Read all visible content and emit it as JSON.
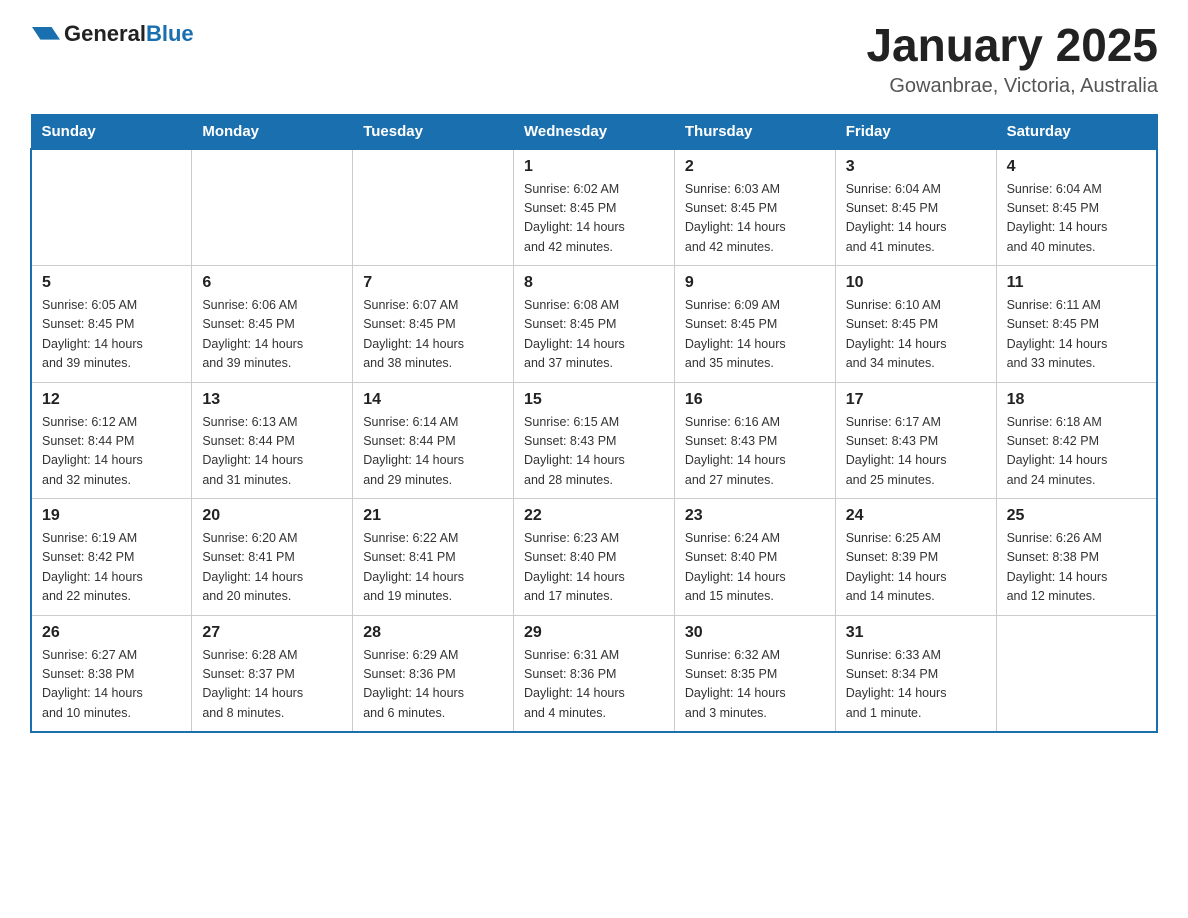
{
  "logo": {
    "general": "General",
    "blue": "Blue"
  },
  "title": "January 2025",
  "location": "Gowanbrae, Victoria, Australia",
  "days_of_week": [
    "Sunday",
    "Monday",
    "Tuesday",
    "Wednesday",
    "Thursday",
    "Friday",
    "Saturday"
  ],
  "weeks": [
    [
      {
        "day": "",
        "info": ""
      },
      {
        "day": "",
        "info": ""
      },
      {
        "day": "",
        "info": ""
      },
      {
        "day": "1",
        "info": "Sunrise: 6:02 AM\nSunset: 8:45 PM\nDaylight: 14 hours\nand 42 minutes."
      },
      {
        "day": "2",
        "info": "Sunrise: 6:03 AM\nSunset: 8:45 PM\nDaylight: 14 hours\nand 42 minutes."
      },
      {
        "day": "3",
        "info": "Sunrise: 6:04 AM\nSunset: 8:45 PM\nDaylight: 14 hours\nand 41 minutes."
      },
      {
        "day": "4",
        "info": "Sunrise: 6:04 AM\nSunset: 8:45 PM\nDaylight: 14 hours\nand 40 minutes."
      }
    ],
    [
      {
        "day": "5",
        "info": "Sunrise: 6:05 AM\nSunset: 8:45 PM\nDaylight: 14 hours\nand 39 minutes."
      },
      {
        "day": "6",
        "info": "Sunrise: 6:06 AM\nSunset: 8:45 PM\nDaylight: 14 hours\nand 39 minutes."
      },
      {
        "day": "7",
        "info": "Sunrise: 6:07 AM\nSunset: 8:45 PM\nDaylight: 14 hours\nand 38 minutes."
      },
      {
        "day": "8",
        "info": "Sunrise: 6:08 AM\nSunset: 8:45 PM\nDaylight: 14 hours\nand 37 minutes."
      },
      {
        "day": "9",
        "info": "Sunrise: 6:09 AM\nSunset: 8:45 PM\nDaylight: 14 hours\nand 35 minutes."
      },
      {
        "day": "10",
        "info": "Sunrise: 6:10 AM\nSunset: 8:45 PM\nDaylight: 14 hours\nand 34 minutes."
      },
      {
        "day": "11",
        "info": "Sunrise: 6:11 AM\nSunset: 8:45 PM\nDaylight: 14 hours\nand 33 minutes."
      }
    ],
    [
      {
        "day": "12",
        "info": "Sunrise: 6:12 AM\nSunset: 8:44 PM\nDaylight: 14 hours\nand 32 minutes."
      },
      {
        "day": "13",
        "info": "Sunrise: 6:13 AM\nSunset: 8:44 PM\nDaylight: 14 hours\nand 31 minutes."
      },
      {
        "day": "14",
        "info": "Sunrise: 6:14 AM\nSunset: 8:44 PM\nDaylight: 14 hours\nand 29 minutes."
      },
      {
        "day": "15",
        "info": "Sunrise: 6:15 AM\nSunset: 8:43 PM\nDaylight: 14 hours\nand 28 minutes."
      },
      {
        "day": "16",
        "info": "Sunrise: 6:16 AM\nSunset: 8:43 PM\nDaylight: 14 hours\nand 27 minutes."
      },
      {
        "day": "17",
        "info": "Sunrise: 6:17 AM\nSunset: 8:43 PM\nDaylight: 14 hours\nand 25 minutes."
      },
      {
        "day": "18",
        "info": "Sunrise: 6:18 AM\nSunset: 8:42 PM\nDaylight: 14 hours\nand 24 minutes."
      }
    ],
    [
      {
        "day": "19",
        "info": "Sunrise: 6:19 AM\nSunset: 8:42 PM\nDaylight: 14 hours\nand 22 minutes."
      },
      {
        "day": "20",
        "info": "Sunrise: 6:20 AM\nSunset: 8:41 PM\nDaylight: 14 hours\nand 20 minutes."
      },
      {
        "day": "21",
        "info": "Sunrise: 6:22 AM\nSunset: 8:41 PM\nDaylight: 14 hours\nand 19 minutes."
      },
      {
        "day": "22",
        "info": "Sunrise: 6:23 AM\nSunset: 8:40 PM\nDaylight: 14 hours\nand 17 minutes."
      },
      {
        "day": "23",
        "info": "Sunrise: 6:24 AM\nSunset: 8:40 PM\nDaylight: 14 hours\nand 15 minutes."
      },
      {
        "day": "24",
        "info": "Sunrise: 6:25 AM\nSunset: 8:39 PM\nDaylight: 14 hours\nand 14 minutes."
      },
      {
        "day": "25",
        "info": "Sunrise: 6:26 AM\nSunset: 8:38 PM\nDaylight: 14 hours\nand 12 minutes."
      }
    ],
    [
      {
        "day": "26",
        "info": "Sunrise: 6:27 AM\nSunset: 8:38 PM\nDaylight: 14 hours\nand 10 minutes."
      },
      {
        "day": "27",
        "info": "Sunrise: 6:28 AM\nSunset: 8:37 PM\nDaylight: 14 hours\nand 8 minutes."
      },
      {
        "day": "28",
        "info": "Sunrise: 6:29 AM\nSunset: 8:36 PM\nDaylight: 14 hours\nand 6 minutes."
      },
      {
        "day": "29",
        "info": "Sunrise: 6:31 AM\nSunset: 8:36 PM\nDaylight: 14 hours\nand 4 minutes."
      },
      {
        "day": "30",
        "info": "Sunrise: 6:32 AM\nSunset: 8:35 PM\nDaylight: 14 hours\nand 3 minutes."
      },
      {
        "day": "31",
        "info": "Sunrise: 6:33 AM\nSunset: 8:34 PM\nDaylight: 14 hours\nand 1 minute."
      },
      {
        "day": "",
        "info": ""
      }
    ]
  ]
}
